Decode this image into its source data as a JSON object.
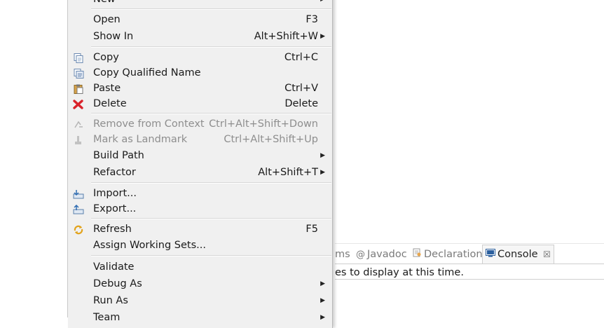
{
  "menu": {
    "items": [
      {
        "label": "New",
        "accel": "",
        "submenu": true,
        "disabled": false,
        "icon": ""
      },
      {
        "label": "Open",
        "accel": "F3",
        "submenu": false,
        "disabled": false,
        "icon": ""
      },
      {
        "label": "Show In",
        "accel": "Alt+Shift+W",
        "submenu": true,
        "disabled": false,
        "icon": ""
      },
      {
        "label": "Copy",
        "accel": "Ctrl+C",
        "submenu": false,
        "disabled": false,
        "icon": "copy-icon"
      },
      {
        "label": "Copy Qualified Name",
        "accel": "",
        "submenu": false,
        "disabled": false,
        "icon": "copy-qualified-icon"
      },
      {
        "label": "Paste",
        "accel": "Ctrl+V",
        "submenu": false,
        "disabled": false,
        "icon": "paste-icon"
      },
      {
        "label": "Delete",
        "accel": "Delete",
        "submenu": false,
        "disabled": false,
        "icon": "delete-icon"
      },
      {
        "label": "Remove from Context",
        "accel": "Ctrl+Alt+Shift+Down",
        "submenu": false,
        "disabled": true,
        "icon": "remove-context-icon"
      },
      {
        "label": "Mark as Landmark",
        "accel": "Ctrl+Alt+Shift+Up",
        "submenu": false,
        "disabled": true,
        "icon": "landmark-icon"
      },
      {
        "label": "Build Path",
        "accel": "",
        "submenu": true,
        "disabled": false,
        "icon": ""
      },
      {
        "label": "Refactor",
        "accel": "Alt+Shift+T",
        "submenu": true,
        "disabled": false,
        "icon": ""
      },
      {
        "label": "Import...",
        "accel": "",
        "submenu": false,
        "disabled": false,
        "icon": "import-icon"
      },
      {
        "label": "Export...",
        "accel": "",
        "submenu": false,
        "disabled": false,
        "icon": "export-icon"
      },
      {
        "label": "Refresh",
        "accel": "F5",
        "submenu": false,
        "disabled": false,
        "icon": "refresh-icon"
      },
      {
        "label": "Assign Working Sets...",
        "accel": "",
        "submenu": false,
        "disabled": false,
        "icon": ""
      },
      {
        "label": "Validate",
        "accel": "",
        "submenu": false,
        "disabled": false,
        "icon": ""
      },
      {
        "label": "Debug As",
        "accel": "",
        "submenu": true,
        "disabled": false,
        "icon": ""
      },
      {
        "label": "Run As",
        "accel": "",
        "submenu": true,
        "disabled": false,
        "icon": ""
      },
      {
        "label": "Team",
        "accel": "",
        "submenu": true,
        "disabled": false,
        "icon": ""
      }
    ]
  },
  "panel": {
    "tabs": [
      {
        "label": "ms",
        "active": false,
        "icon": ""
      },
      {
        "label": "Javadoc",
        "active": false,
        "icon": "@"
      },
      {
        "label": "Declaration",
        "active": false,
        "icon": "declaration-icon"
      },
      {
        "label": "Console",
        "active": true,
        "icon": "console-icon"
      }
    ],
    "close_glyph": "☒",
    "console_message": "es to display at this time."
  }
}
